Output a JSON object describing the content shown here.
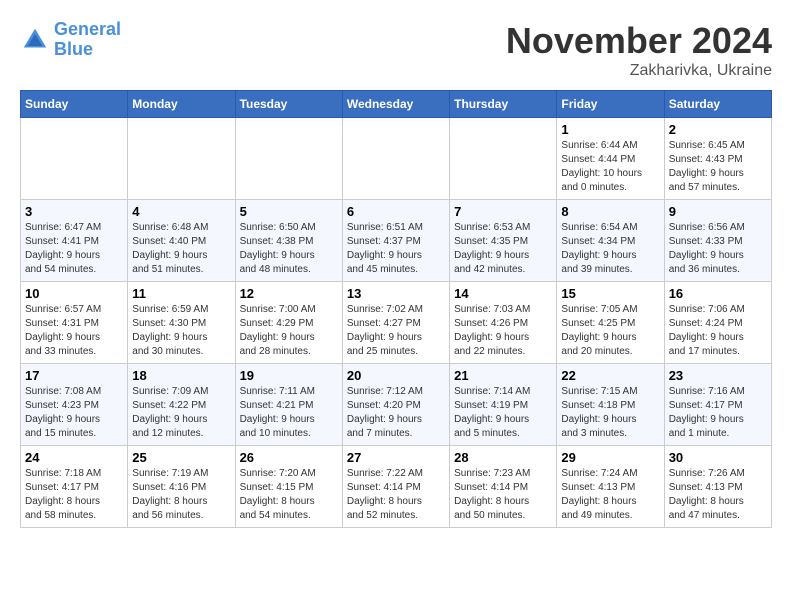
{
  "header": {
    "logo_line1": "General",
    "logo_line2": "Blue",
    "month": "November 2024",
    "location": "Zakharivka, Ukraine"
  },
  "weekdays": [
    "Sunday",
    "Monday",
    "Tuesday",
    "Wednesday",
    "Thursday",
    "Friday",
    "Saturday"
  ],
  "weeks": [
    [
      {
        "day": "",
        "info": ""
      },
      {
        "day": "",
        "info": ""
      },
      {
        "day": "",
        "info": ""
      },
      {
        "day": "",
        "info": ""
      },
      {
        "day": "",
        "info": ""
      },
      {
        "day": "1",
        "info": "Sunrise: 6:44 AM\nSunset: 4:44 PM\nDaylight: 10 hours\nand 0 minutes."
      },
      {
        "day": "2",
        "info": "Sunrise: 6:45 AM\nSunset: 4:43 PM\nDaylight: 9 hours\nand 57 minutes."
      }
    ],
    [
      {
        "day": "3",
        "info": "Sunrise: 6:47 AM\nSunset: 4:41 PM\nDaylight: 9 hours\nand 54 minutes."
      },
      {
        "day": "4",
        "info": "Sunrise: 6:48 AM\nSunset: 4:40 PM\nDaylight: 9 hours\nand 51 minutes."
      },
      {
        "day": "5",
        "info": "Sunrise: 6:50 AM\nSunset: 4:38 PM\nDaylight: 9 hours\nand 48 minutes."
      },
      {
        "day": "6",
        "info": "Sunrise: 6:51 AM\nSunset: 4:37 PM\nDaylight: 9 hours\nand 45 minutes."
      },
      {
        "day": "7",
        "info": "Sunrise: 6:53 AM\nSunset: 4:35 PM\nDaylight: 9 hours\nand 42 minutes."
      },
      {
        "day": "8",
        "info": "Sunrise: 6:54 AM\nSunset: 4:34 PM\nDaylight: 9 hours\nand 39 minutes."
      },
      {
        "day": "9",
        "info": "Sunrise: 6:56 AM\nSunset: 4:33 PM\nDaylight: 9 hours\nand 36 minutes."
      }
    ],
    [
      {
        "day": "10",
        "info": "Sunrise: 6:57 AM\nSunset: 4:31 PM\nDaylight: 9 hours\nand 33 minutes."
      },
      {
        "day": "11",
        "info": "Sunrise: 6:59 AM\nSunset: 4:30 PM\nDaylight: 9 hours\nand 30 minutes."
      },
      {
        "day": "12",
        "info": "Sunrise: 7:00 AM\nSunset: 4:29 PM\nDaylight: 9 hours\nand 28 minutes."
      },
      {
        "day": "13",
        "info": "Sunrise: 7:02 AM\nSunset: 4:27 PM\nDaylight: 9 hours\nand 25 minutes."
      },
      {
        "day": "14",
        "info": "Sunrise: 7:03 AM\nSunset: 4:26 PM\nDaylight: 9 hours\nand 22 minutes."
      },
      {
        "day": "15",
        "info": "Sunrise: 7:05 AM\nSunset: 4:25 PM\nDaylight: 9 hours\nand 20 minutes."
      },
      {
        "day": "16",
        "info": "Sunrise: 7:06 AM\nSunset: 4:24 PM\nDaylight: 9 hours\nand 17 minutes."
      }
    ],
    [
      {
        "day": "17",
        "info": "Sunrise: 7:08 AM\nSunset: 4:23 PM\nDaylight: 9 hours\nand 15 minutes."
      },
      {
        "day": "18",
        "info": "Sunrise: 7:09 AM\nSunset: 4:22 PM\nDaylight: 9 hours\nand 12 minutes."
      },
      {
        "day": "19",
        "info": "Sunrise: 7:11 AM\nSunset: 4:21 PM\nDaylight: 9 hours\nand 10 minutes."
      },
      {
        "day": "20",
        "info": "Sunrise: 7:12 AM\nSunset: 4:20 PM\nDaylight: 9 hours\nand 7 minutes."
      },
      {
        "day": "21",
        "info": "Sunrise: 7:14 AM\nSunset: 4:19 PM\nDaylight: 9 hours\nand 5 minutes."
      },
      {
        "day": "22",
        "info": "Sunrise: 7:15 AM\nSunset: 4:18 PM\nDaylight: 9 hours\nand 3 minutes."
      },
      {
        "day": "23",
        "info": "Sunrise: 7:16 AM\nSunset: 4:17 PM\nDaylight: 9 hours\nand 1 minute."
      }
    ],
    [
      {
        "day": "24",
        "info": "Sunrise: 7:18 AM\nSunset: 4:17 PM\nDaylight: 8 hours\nand 58 minutes."
      },
      {
        "day": "25",
        "info": "Sunrise: 7:19 AM\nSunset: 4:16 PM\nDaylight: 8 hours\nand 56 minutes."
      },
      {
        "day": "26",
        "info": "Sunrise: 7:20 AM\nSunset: 4:15 PM\nDaylight: 8 hours\nand 54 minutes."
      },
      {
        "day": "27",
        "info": "Sunrise: 7:22 AM\nSunset: 4:14 PM\nDaylight: 8 hours\nand 52 minutes."
      },
      {
        "day": "28",
        "info": "Sunrise: 7:23 AM\nSunset: 4:14 PM\nDaylight: 8 hours\nand 50 minutes."
      },
      {
        "day": "29",
        "info": "Sunrise: 7:24 AM\nSunset: 4:13 PM\nDaylight: 8 hours\nand 49 minutes."
      },
      {
        "day": "30",
        "info": "Sunrise: 7:26 AM\nSunset: 4:13 PM\nDaylight: 8 hours\nand 47 minutes."
      }
    ]
  ]
}
